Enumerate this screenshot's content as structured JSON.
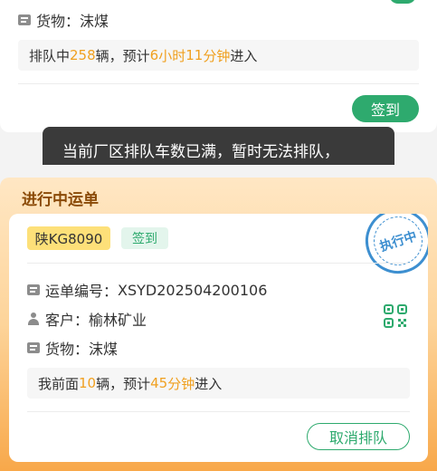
{
  "previous_card": {
    "cargo_label": "货物：",
    "cargo_value": "沫煤",
    "queue": {
      "prefix": "排队中",
      "count": "258",
      "mid": "辆，预计",
      "hours": "6",
      "hour_unit": "小时",
      "minutes": "11",
      "minute_unit": "分钟",
      "suffix": "进入"
    },
    "signin_label": "签到"
  },
  "toast": {
    "message": "当前厂区排队车数已满，暂时无法排队，"
  },
  "active_section": {
    "title": "进行中运单",
    "card": {
      "plate": "陕KG8090",
      "status_tag": "签到",
      "stamp_text": "执行中",
      "waybill_label": "运单编号：",
      "waybill_value": "XSYD202504200106",
      "customer_label": "客户：",
      "customer_value": "榆林矿业",
      "cargo_label": "货物：",
      "cargo_value": "沫煤",
      "queue": {
        "prefix": "我前面",
        "count": "10",
        "mid": "辆，预计",
        "minutes": "45",
        "minute_unit": "分钟",
        "suffix": "进入"
      },
      "cancel_label": "取消排队"
    }
  },
  "colors": {
    "accent_green": "#2eaa6e",
    "highlight_orange": "#f0a020",
    "stamp_blue": "#3d8fd0",
    "plate_yellow": "#fde079"
  },
  "icons": {
    "document": "document-icon",
    "person": "person-icon",
    "qr": "qr-code-icon"
  }
}
